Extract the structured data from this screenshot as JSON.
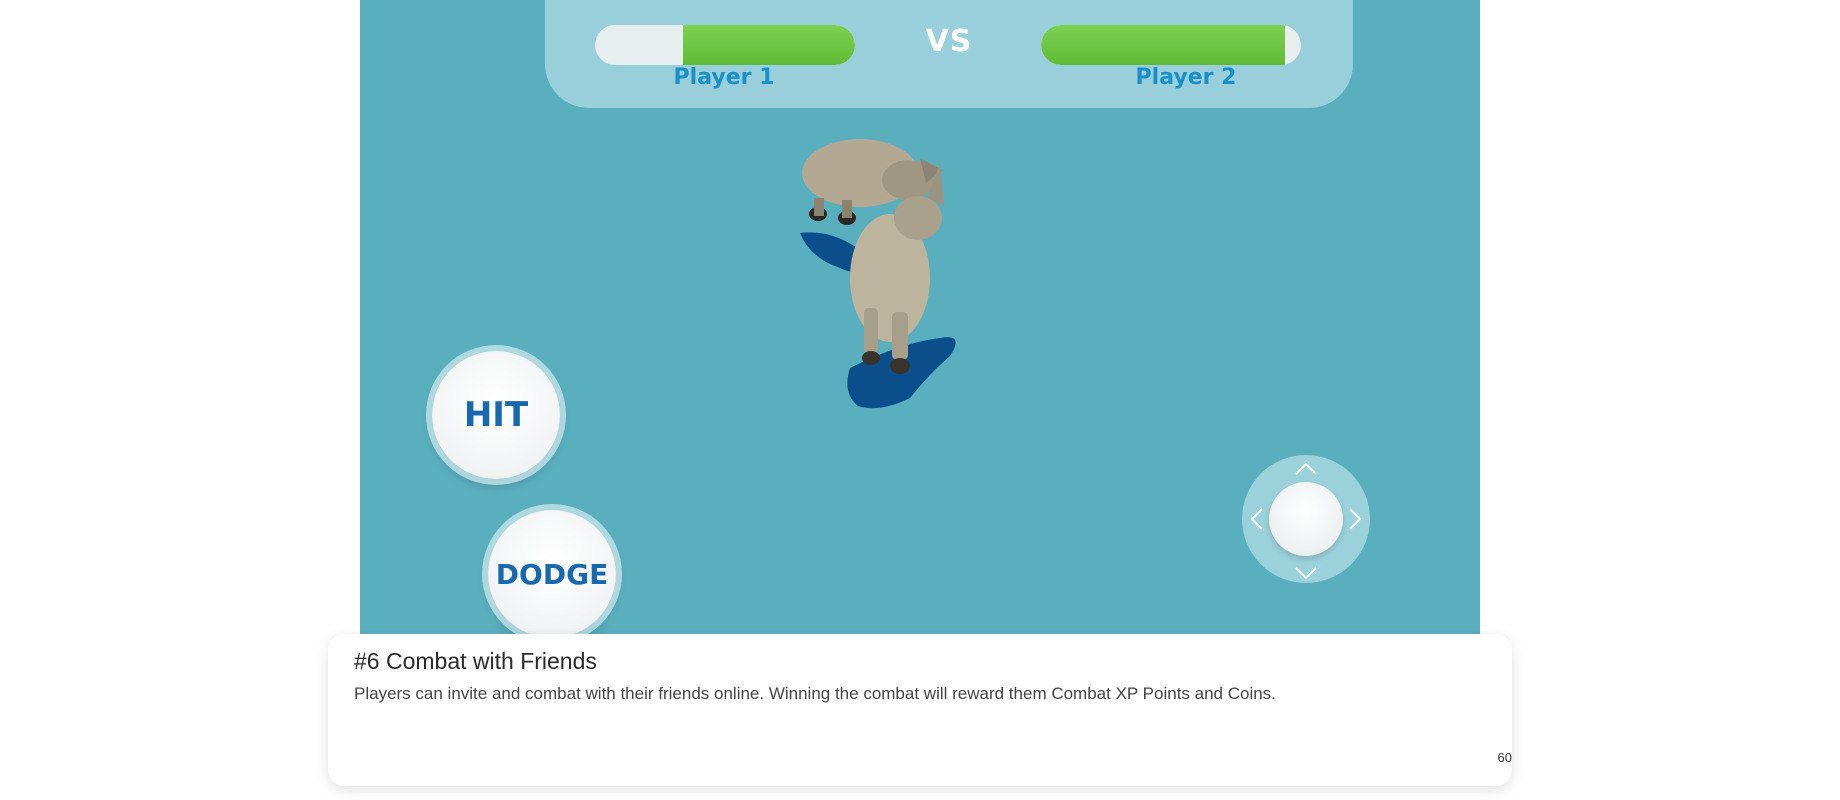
{
  "hud": {
    "player1_label": "Player 1",
    "player2_label": "Player 2",
    "vs_label": "VS",
    "player1_health": 0.66,
    "player2_health": 0.94
  },
  "controls": {
    "hit_label": "HIT",
    "dodge_label": "DODGE",
    "joystick_icons": [
      "chevron-up-icon",
      "chevron-down-icon",
      "chevron-left-icon",
      "chevron-right-icon"
    ]
  },
  "feature": {
    "title": "#6 Combat with Friends",
    "description": "Players can invite and combat with their friends online. Winning the combat will reward them Combat XP Points and Coins."
  },
  "page_number": "60",
  "colors": {
    "arena": "#5aafbf",
    "health_fill": "#6cc540",
    "player_label": "#1a8fc8",
    "button_text": "#1868ae"
  }
}
